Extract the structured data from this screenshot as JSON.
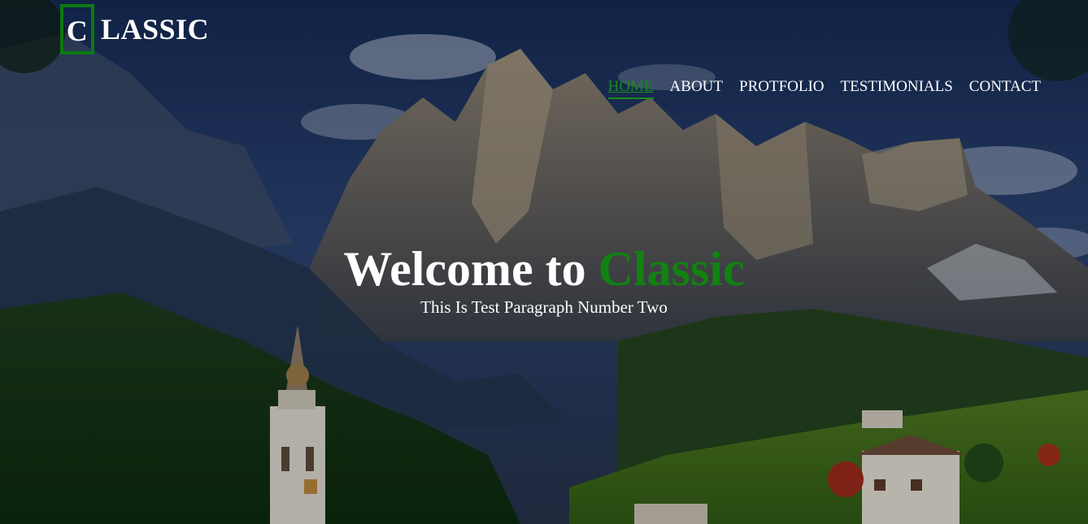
{
  "logo": {
    "boxed_letter": "C",
    "rest": "LASSIC",
    "accent_color": "#0a7a12"
  },
  "nav": {
    "items": [
      {
        "label": "HOME",
        "active": true
      },
      {
        "label": "ABOUT",
        "active": false
      },
      {
        "label": "PROTFOLIO",
        "active": false
      },
      {
        "label": "TESTIMONIALS",
        "active": false
      },
      {
        "label": "CONTACT",
        "active": false
      }
    ],
    "active_color": "#1a8a1f"
  },
  "hero": {
    "welcome_prefix": "Welcome to",
    "welcome_accent": "Classic",
    "accent_color": "#118211",
    "subtitle": "This Is Test Paragraph Number Two",
    "background_image": "mountain-village-landscape"
  }
}
